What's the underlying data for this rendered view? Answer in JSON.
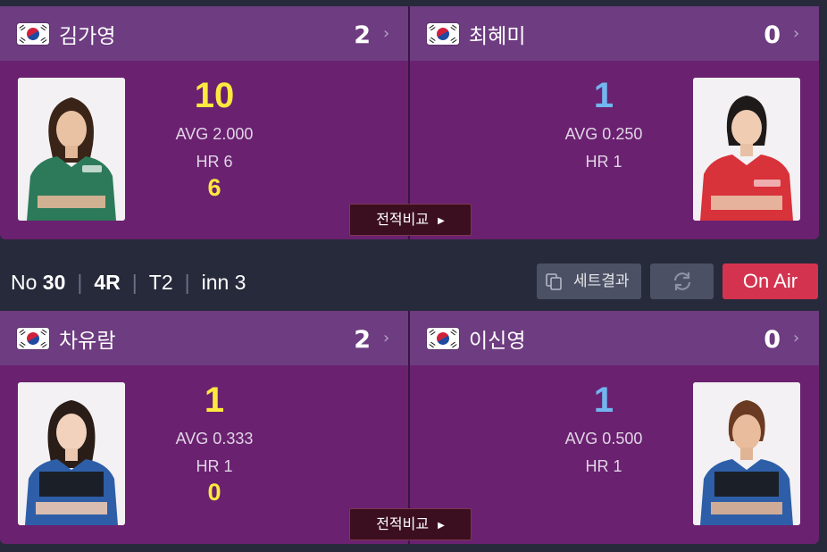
{
  "matches": [
    {
      "left": {
        "flag": "korea-flag-icon",
        "name": "김가영",
        "set_score": "2",
        "score": "10",
        "score_color": "#ffe93f",
        "avg": "AVG 2.000",
        "hr": "HR 6",
        "high_run": "6",
        "uniform_color": "#2d7a5a"
      },
      "right": {
        "flag": "korea-flag-icon",
        "name": "최혜미",
        "set_score": "0",
        "score": "1",
        "score_color": "#72b6f0",
        "avg": "AVG 0.250",
        "hr": "HR 1",
        "high_run": "",
        "uniform_color": "#d8323a"
      },
      "compare_label": "전적비교"
    },
    {
      "left": {
        "flag": "korea-flag-icon",
        "name": "차유람",
        "set_score": "2",
        "score": "1",
        "score_color": "#ffe93f",
        "avg": "AVG 0.333",
        "hr": "HR 1",
        "high_run": "0",
        "uniform_color": "#2e5ea8"
      },
      "right": {
        "flag": "korea-flag-icon",
        "name": "이신영",
        "set_score": "0",
        "score": "1",
        "score_color": "#72b6f0",
        "avg": "AVG 0.500",
        "hr": "HR 1",
        "high_run": "",
        "uniform_color": "#2e5ea8"
      },
      "compare_label": "전적비교"
    }
  ],
  "infobar": {
    "no_label": "No",
    "no_value": "30",
    "round": "4R",
    "table": "T2",
    "inning": "inn 3",
    "set_result_label": "세트결과",
    "set_result_icon": "copy-icon",
    "refresh_icon": "refresh-icon",
    "on_air_label": "On Air",
    "on_air_color": "#d4334f"
  }
}
